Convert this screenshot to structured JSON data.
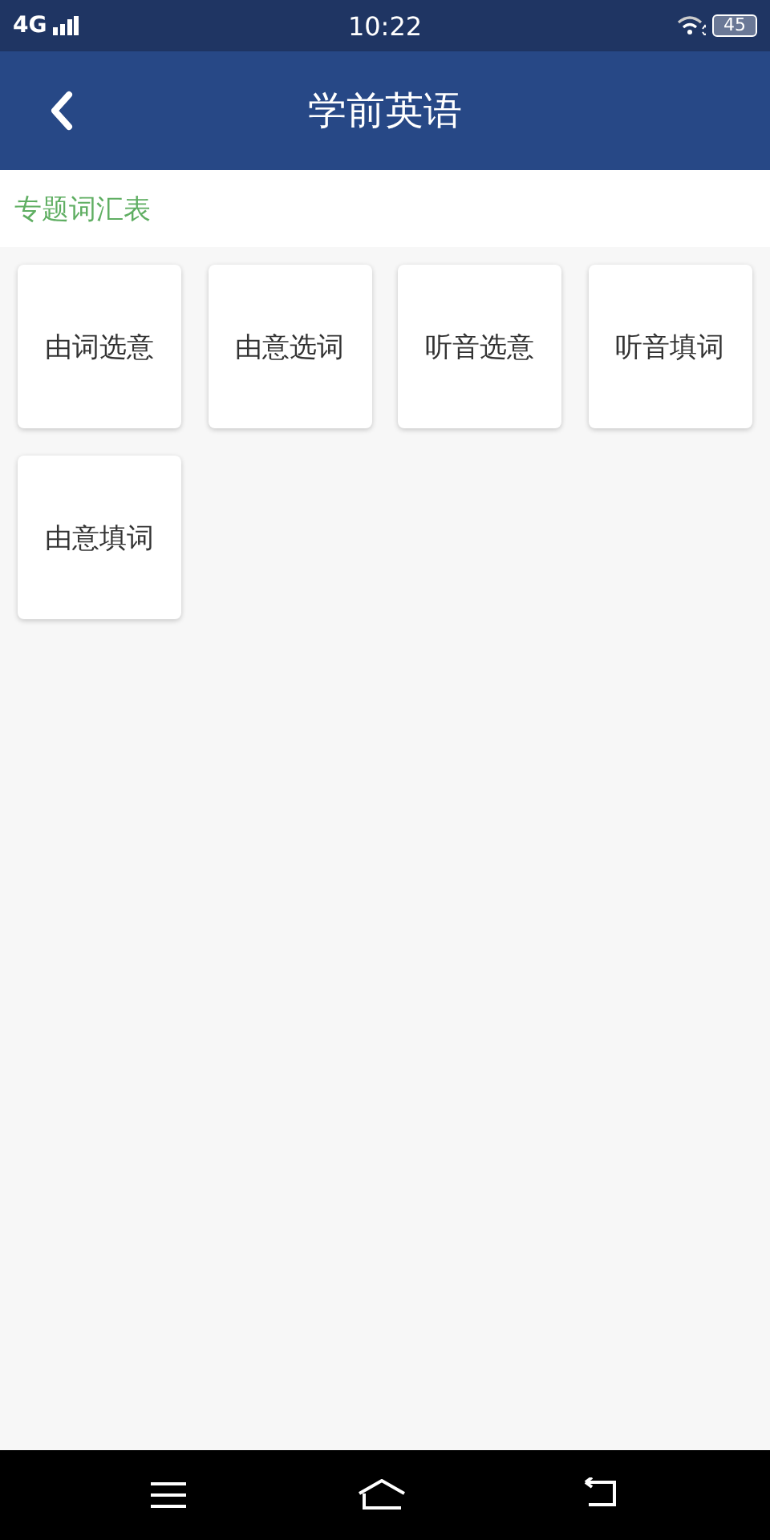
{
  "status_bar": {
    "network": "4G",
    "time": "10:22",
    "battery": "45"
  },
  "header": {
    "title": "学前英语"
  },
  "section": {
    "title": "专题词汇表"
  },
  "cards": [
    {
      "label": "由词选意"
    },
    {
      "label": "由意选词"
    },
    {
      "label": "听音选意"
    },
    {
      "label": "听音填词"
    },
    {
      "label": "由意填词"
    }
  ]
}
